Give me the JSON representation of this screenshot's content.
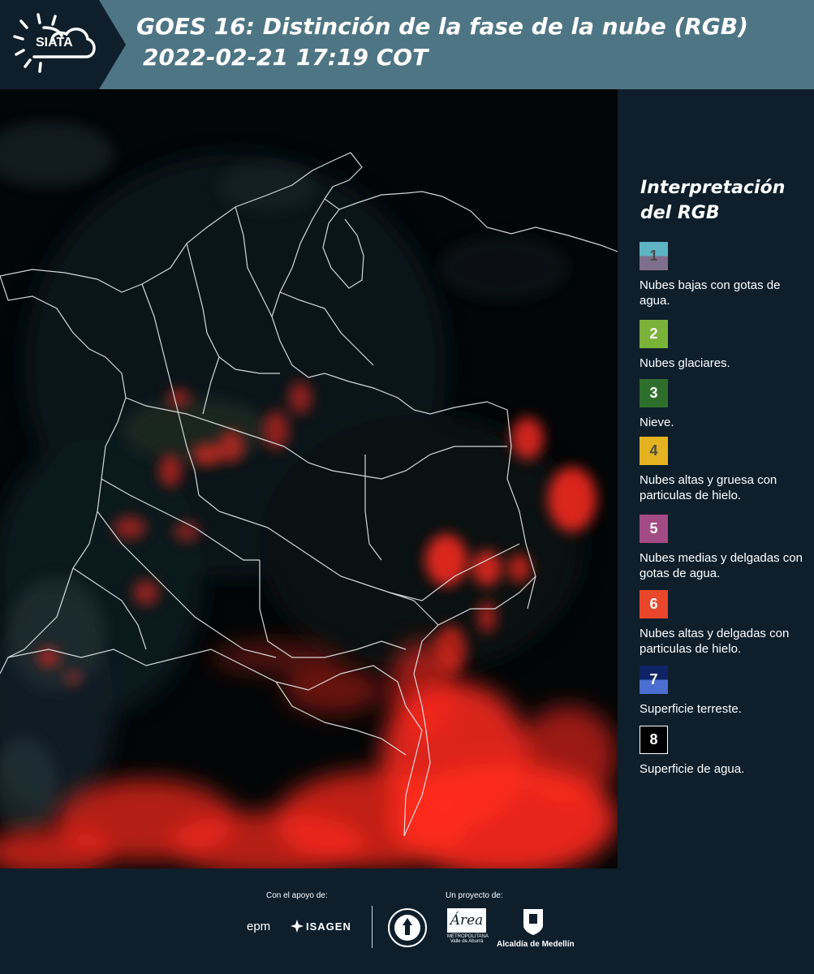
{
  "header": {
    "logo_text": "SIATA",
    "title_line1": "GOES 16: Distinción de la fase de la nube (RGB)",
    "title_line2": "2022-02-21 17:19 COT"
  },
  "map": {
    "description_icon": "satellite-rgb-map",
    "colors": {
      "background": "#030607",
      "borders": "#e8eef0",
      "cloud_ice": "#ff2a1e"
    }
  },
  "legend": {
    "title": "Interpretación del RGB",
    "items": [
      {
        "number": "1",
        "label": "Nubes bajas con gotas de agua.",
        "color_top": "#5fb4c4",
        "color_bottom": "#7e6f8c",
        "text_color": "#4a4a4a"
      },
      {
        "number": "2",
        "label": "Nubes glaciares.",
        "color_top": "#7ab23a",
        "color_bottom": "#7ab23a",
        "text_color": "#ffffff"
      },
      {
        "number": "3",
        "label": "Nieve.",
        "color_top": "#2f6f2c",
        "color_bottom": "#2f6f2c",
        "text_color": "#ffffff"
      },
      {
        "number": "4",
        "label": "Nubes altas y gruesa con particulas de hielo.",
        "color_top": "#e5b321",
        "color_bottom": "#e5b321",
        "text_color": "#4a4a4a"
      },
      {
        "number": "5",
        "label": "Nubes medias y delgadas con gotas de agua.",
        "color_top": "#a34b84",
        "color_bottom": "#a34b84",
        "text_color": "#ffffff"
      },
      {
        "number": "6",
        "label": "Nubes altas y delgadas con particulas de hielo.",
        "color_top": "#e8472c",
        "color_bottom": "#e8472c",
        "text_color": "#ffffff"
      },
      {
        "number": "7",
        "label": "Superficie terreste.",
        "color_top": "#0f2466",
        "color_bottom": "#4a6fd0",
        "text_color": "#ffffff"
      },
      {
        "number": "8",
        "label": "Superficie de agua.",
        "color_top": "#000000",
        "color_bottom": "#000000",
        "text_color": "#ffffff"
      }
    ]
  },
  "footer": {
    "support_label": "Con el apoyo de:",
    "project_label": "Un proyecto de:",
    "sponsors": [
      "epm",
      "ISAGEN"
    ],
    "partners": [
      "METROPOLITANA",
      "Alcaldía de Medellín"
    ],
    "area_script": "Área",
    "area_sub": "Valle de Aburrá"
  }
}
